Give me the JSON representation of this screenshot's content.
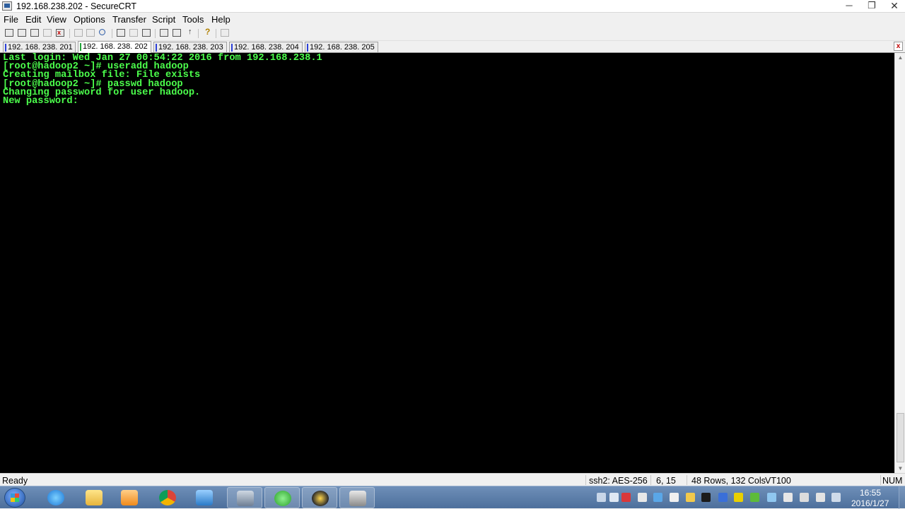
{
  "window": {
    "title": "192.168.238.202 - SecureCRT",
    "minimize": "─",
    "maximize": "❐",
    "close": "✕"
  },
  "menu": [
    "File",
    "Edit",
    "View",
    "Options",
    "Transfer",
    "Script",
    "Tools",
    "Help"
  ],
  "tabs": [
    {
      "label": "192. 168. 238. 201",
      "active": false
    },
    {
      "label": "192. 168. 238. 202",
      "active": true
    },
    {
      "label": "192. 168. 238. 203",
      "active": false
    },
    {
      "label": "192. 168. 238. 204",
      "active": false
    },
    {
      "label": "192. 168. 238. 205",
      "active": false
    }
  ],
  "tab_close": "x",
  "terminal": {
    "lines": [
      "Last login: Wed Jan 27 00:54:22 2016 from 192.168.238.1",
      "[root@hadoop2 ~]# useradd hadoop",
      "Creating mailbox file: File exists",
      "[root@hadoop2 ~]# passwd hadoop",
      "Changing password for user hadoop.",
      "New password:"
    ],
    "text_color": "#4cff4c",
    "background": "#000000"
  },
  "scrollbar": {
    "up": "▲",
    "down": "▼"
  },
  "status": {
    "ready": "Ready",
    "cipher": "ssh2: AES-256",
    "cursor": "6,  15",
    "size": "48 Rows, 132 Cols",
    "emulation": "VT100",
    "numlock": "NUM"
  },
  "toolbar_icons": [
    "connect-icon",
    "quick-connect-icon",
    "connect-in-tab-icon",
    "reconnect-icon",
    "disconnect-icon",
    "copy-icon",
    "paste-icon",
    "find-icon",
    "print-setup-icon",
    "print-selection-icon",
    "print-icon",
    "session-options-icon",
    "global-options-icon",
    "keymap-icon",
    "help-icon",
    "sftp-icon"
  ],
  "taskbar": {
    "apps": [
      "internet-explorer-icon",
      "file-explorer-icon",
      "media-player-icon",
      "chrome-icon",
      "vmware-icon",
      "lock-app-icon",
      "refresh-app-icon",
      "e-app-icon",
      "securecrt-icon"
    ],
    "clock_time": "16:55",
    "clock_date": "2016/1/27"
  }
}
